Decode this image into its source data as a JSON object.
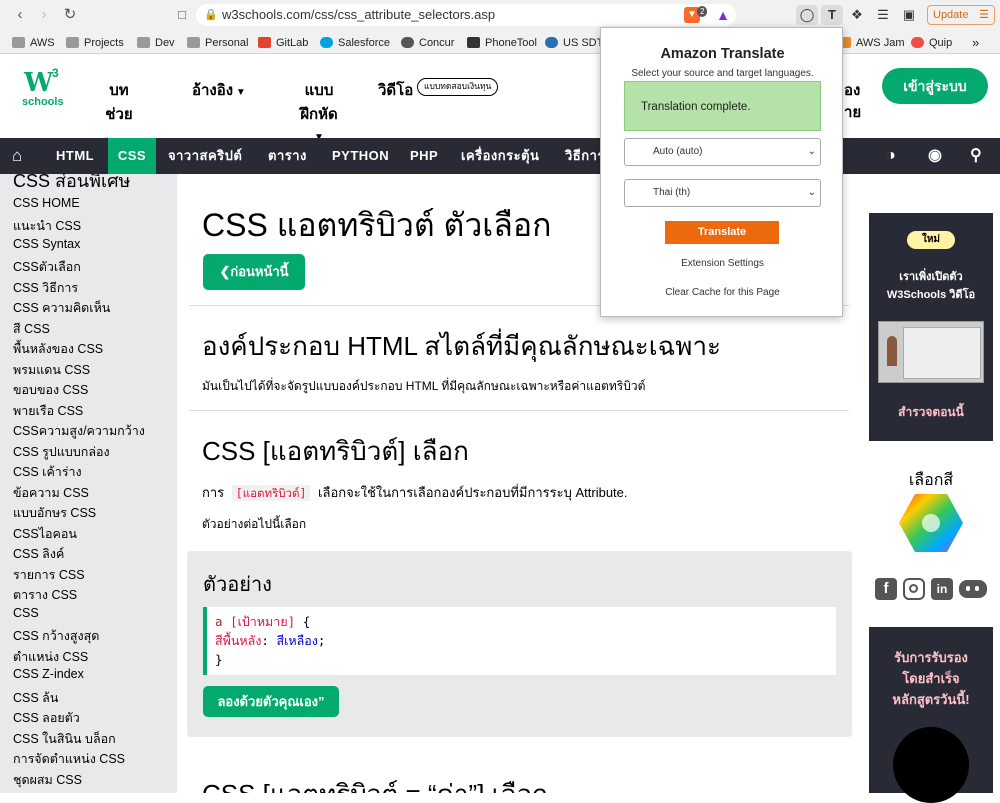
{
  "browser": {
    "url": "w3schools.com/css/css_attribute_selectors.asp",
    "update_label": "Update",
    "brave_badge": "2",
    "bookmarks": [
      "AWS",
      "Projects",
      "Dev",
      "Personal",
      "GitLab",
      "Salesforce",
      "Concur",
      "PhoneTool",
      "US SDT",
      "AWS Jam",
      "Quip"
    ],
    "more_label": "»"
  },
  "header": {
    "logo_top": "W",
    "logo_sup": "3",
    "logo_bottom": "schools",
    "menu1_line1": "บทช่วย",
    "menu1_line2": "สอน",
    "menu2": "อ้างอิง",
    "menu3": "แบบฝึกหัด",
    "menu4": "วิดีโอ",
    "badge": "แบบทดสอบเงินทุน",
    "partial1": "อง",
    "partial2": "าย",
    "login": "เข้าสู่ระบบ"
  },
  "navbar": {
    "items": [
      "HTML",
      "CSS",
      "จาวาสคริปต์",
      "ตาราง",
      "PYTHON",
      "PHP",
      "เครื่องกระตุ้น",
      "วิธีการ"
    ]
  },
  "sidebar": {
    "heading": "CSS ส่อนพิเศษ",
    "items": [
      "CSS HOME",
      "แนะนำ CSS",
      "CSS Syntax",
      "CSSตัวเลือก",
      "CSS วิธีการ",
      "CSS ความคิดเห็น",
      "สี CSS",
      "พื้นหลังของ CSS",
      "พรมแดน CSS",
      "ขอบของ CSS",
      "พายเรือ CSS",
      "CSSความสูง/ความกว้าง",
      "CSS รูปแบบกล่อง",
      "CSS เค้าร่าง",
      "ข้อความ CSS",
      "แบบอักษร CSS",
      "CSSไอคอน",
      "CSS ลิงค์",
      "รายการ CSS",
      "ตาราง CSS",
      "CSS",
      "CSS กว้างสูงสุด",
      "ตำแหน่ง CSS",
      "CSS Z-index",
      "CSS ล้น",
      "CSS ลอยตัว",
      "CSS ในสินิน บล็อก",
      "การจัดตำแหน่ง CSS",
      "ชุดผสม CSS"
    ]
  },
  "main": {
    "title": "CSS แอตทริบิวต์ ตัวเลือก",
    "prev_btn": "❮ก่อนหน้านี้",
    "h2a": "องค์ประกอบ HTML สไตล์ที่มีคุณลักษณะเฉพาะ",
    "p1": "มันเป็นไปได้ที่จะจัดรูปแบบองค์ประกอบ HTML ที่มีคุณลักษณะเฉพาะหรือค่าแอตทริบิวต์",
    "h2b": "CSS [แอตทริบิวต์] เลือก",
    "p2_pre": "การ",
    "p2_code": "[แอตทริบิวต์]",
    "p2_post": "เลือกจะใช้ในการเลือกองค์ประกอบที่มีการระบุ Attribute.",
    "p3": "ตัวอย่างต่อไปนี้เลือก",
    "example_title": "ตัวอย่าง",
    "code_line1_sel": "a",
    "code_line1_attr": "[เป้าหมาย]",
    "code_line1_brace": "{",
    "code_line2_prop": "สีพื้นหลัง",
    "code_line2_colon": ":",
    "code_line2_val": "สีเหลือง",
    "code_line2_semi": ";",
    "code_line3": "}",
    "try_btn": "ลองด้วยตัวคุณเอง”",
    "h2c": "CSS [แอตทริบิวต์ = “ค่า”] เลือก"
  },
  "right": {
    "new_badge": "ใหม่",
    "promo_line1": "เราเพิ่งเปิดตัว",
    "promo_line2": "W3Schools วิดีโอ",
    "explore": "สำรวจตอนนี้",
    "color_heading": "เลือกสี",
    "cert_line1": "รับการรับรอง",
    "cert_line2": "โดยสำเร็จ",
    "cert_line3": "หลักสูตรวันนี้!"
  },
  "popup": {
    "title": "Amazon Translate",
    "subtitle": "Select your source and target languages.",
    "status": "Translation complete.",
    "source_lang": "Auto (auto)",
    "target_lang": "Thai (th)",
    "translate_btn": "Translate",
    "settings_link": "Extension Settings",
    "clear_link": "Clear Cache for this Page"
  },
  "colors": {
    "w3_green": "#04aa6d",
    "navbar_bg": "#282a35",
    "sidebar_bg": "#e7e9eb",
    "translate_orange": "#ec6a0d",
    "status_green": "#b5e2a8"
  }
}
